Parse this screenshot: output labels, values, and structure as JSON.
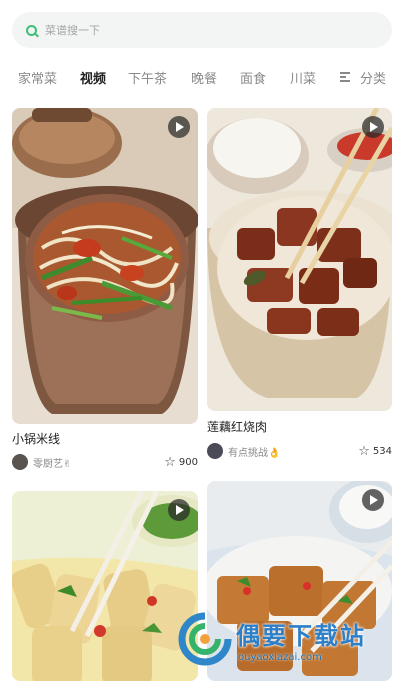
{
  "search": {
    "placeholder": "菜谱搜一下"
  },
  "tabs": [
    {
      "label": "家常菜",
      "active": false
    },
    {
      "label": "视频",
      "active": true
    },
    {
      "label": "下午茶",
      "active": false
    },
    {
      "label": "晚餐",
      "active": false
    },
    {
      "label": "面食",
      "active": false
    },
    {
      "label": "川菜",
      "active": false
    }
  ],
  "category_button": {
    "label": "分类"
  },
  "cards": [
    {
      "title": "小锅米线",
      "author": "零厨艺✌",
      "favorites": "900",
      "dish": "clay-pot-rice-noodles"
    },
    {
      "title": "莲藕红烧肉",
      "author": "有点挑战👌",
      "favorites": "534",
      "dish": "braised-pork-with-lotus-root"
    },
    {
      "title": "",
      "author": "",
      "favorites": "",
      "dish": "tofu-skin-rolls"
    },
    {
      "title": "",
      "author": "",
      "favorites": "",
      "dish": "stuffed-tofu"
    }
  ],
  "watermark": {
    "name": "偶要下载站",
    "url": "ouyaoxiazai.com"
  },
  "colors": {
    "accent": "#3fbf74",
    "active_tab": "#222222",
    "inactive_tab": "#8a8a8a"
  }
}
